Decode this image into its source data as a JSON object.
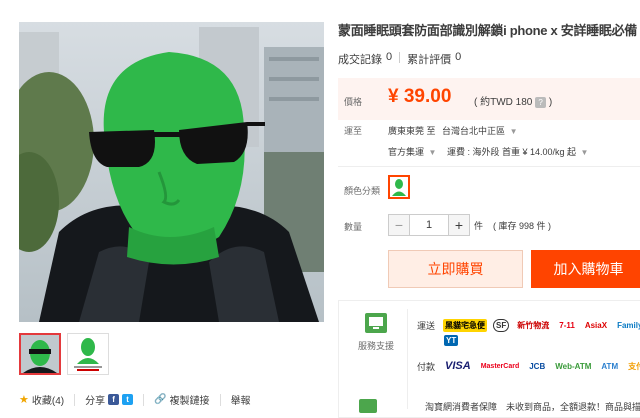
{
  "product": {
    "title": "蒙面睡眠頭套防面部識別解鎖i phone x 安詳睡眠必備",
    "sales_label": "成交記錄",
    "sales_count": "0",
    "reviews_label": "累計評價",
    "reviews_count": "0"
  },
  "price": {
    "label": "價格",
    "value": "¥ 39.00",
    "converted": "( 約TWD 180",
    "converted_end": ")",
    "help": "?"
  },
  "delivery": {
    "label": "運至",
    "from": "廣東東莞 至",
    "to": "台灣台北中正區",
    "carrier": "官方集運",
    "shipping": "運費 : 海外段 首重 ¥ 14.00/kg 起"
  },
  "color": {
    "label": "顏色分類"
  },
  "quantity": {
    "label": "數量",
    "value": "1",
    "unit": "件",
    "stock": "( 庫存 998 件 )",
    "minus": "−",
    "plus": "+"
  },
  "buttons": {
    "buy_now": "立即購買",
    "add_cart": "加入購物車"
  },
  "service": {
    "label": "服務支援",
    "shipping_label": "運送",
    "shipping_logos": [
      "黑貓宅急便",
      "SF",
      "新竹物流",
      "7-11",
      "AsiaX",
      "Family"
    ],
    "payment_label": "付款",
    "payment_logos": [
      "YT",
      "VISA",
      "MasterCard",
      "JCB",
      "Web-ATM",
      "ATM",
      "支付寶"
    ],
    "guarantee": "淘寶網消費者保障　未收到商品，全額退款！商品與描"
  },
  "actions": {
    "favorite": "收藏(4)",
    "share": "分享",
    "copy_link": "複製鏈接",
    "report": "舉報"
  },
  "colors": {
    "accent": "#ff4400",
    "mask_green": "#2fb84a"
  }
}
